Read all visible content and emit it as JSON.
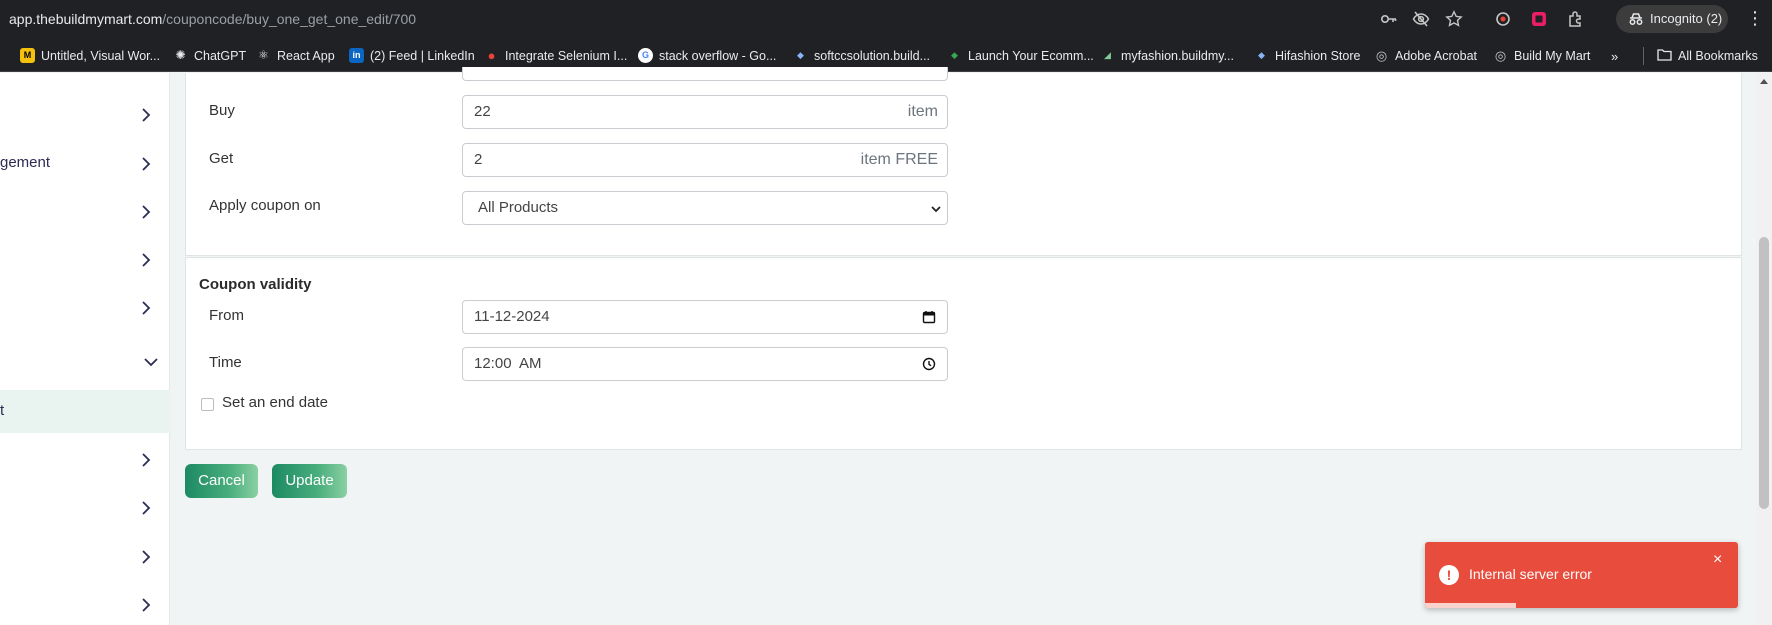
{
  "browser": {
    "url_host": "app.thebuildmymart.com",
    "url_path": "/couponcode/buy_one_get_one_edit/700",
    "incognito_label": "Incognito (2)",
    "bookmarks": [
      {
        "label": "Untitled, Visual Wor...",
        "fav": "M",
        "color": "#f4c20d"
      },
      {
        "label": "ChatGPT",
        "fav": "✺",
        "color": "#5f6368"
      },
      {
        "label": "React App",
        "fav": "⚛",
        "color": "#5f6368"
      },
      {
        "label": "(2) Feed | LinkedIn",
        "fav": "in",
        "color": "#0a66c2"
      },
      {
        "label": "Integrate Selenium I...",
        "fav": "●",
        "color": "#ea4335"
      },
      {
        "label": "stack overflow - Go...",
        "fav": "G",
        "color": "#ffffff"
      },
      {
        "label": "softccsolution.build...",
        "fav": "◆",
        "color": "#3c4043"
      },
      {
        "label": "Launch Your Ecomm...",
        "fav": "◆",
        "color": "#1e8e3e"
      },
      {
        "label": "myfashion.buildmy...",
        "fav": "◢",
        "color": "#3c4043"
      },
      {
        "label": "Hifashion Store",
        "fav": "◆",
        "color": "#3c4043"
      },
      {
        "label": "Adobe Acrobat",
        "fav": "◎",
        "color": "#5f6368"
      },
      {
        "label": "Build My Mart",
        "fav": "◎",
        "color": "#5f6368"
      }
    ],
    "all_bookmarks_label": "All Bookmarks"
  },
  "sidebar": {
    "items": [
      {
        "label": "",
        "chevron": "right",
        "active": false
      },
      {
        "label": "gement",
        "chevron": "right",
        "active": false
      },
      {
        "label": "",
        "chevron": "right",
        "active": false
      },
      {
        "label": "",
        "chevron": "right",
        "active": false
      },
      {
        "label": "",
        "chevron": "right",
        "active": false
      },
      {
        "label": "",
        "chevron": "down",
        "active": false
      },
      {
        "label": "t",
        "chevron": "",
        "active": true
      },
      {
        "label": "",
        "chevron": "right",
        "active": false
      },
      {
        "label": "",
        "chevron": "right",
        "active": false
      },
      {
        "label": "",
        "chevron": "right",
        "active": false
      },
      {
        "label": "",
        "chevron": "right",
        "active": false
      }
    ]
  },
  "form": {
    "buy_label": "Buy",
    "buy_value": "22",
    "buy_suffix": "item",
    "get_label": "Get",
    "get_value": "2",
    "get_suffix": "item FREE",
    "apply_label": "Apply coupon on",
    "apply_value": "All Products",
    "validity_title": "Coupon validity",
    "from_label": "From",
    "from_value": "11-12-2024",
    "time_label": "Time",
    "time_value": "12:00  AM",
    "end_date_label": "Set an end date",
    "end_date_checked": false
  },
  "buttons": {
    "cancel": "Cancel",
    "update": "Update"
  },
  "toast": {
    "message": "Internal server error",
    "close": "×",
    "progress": 0.29,
    "color": "#e74c3c"
  },
  "colors": {
    "brand_green": "#1d8a63",
    "error_red": "#e74c3c"
  }
}
